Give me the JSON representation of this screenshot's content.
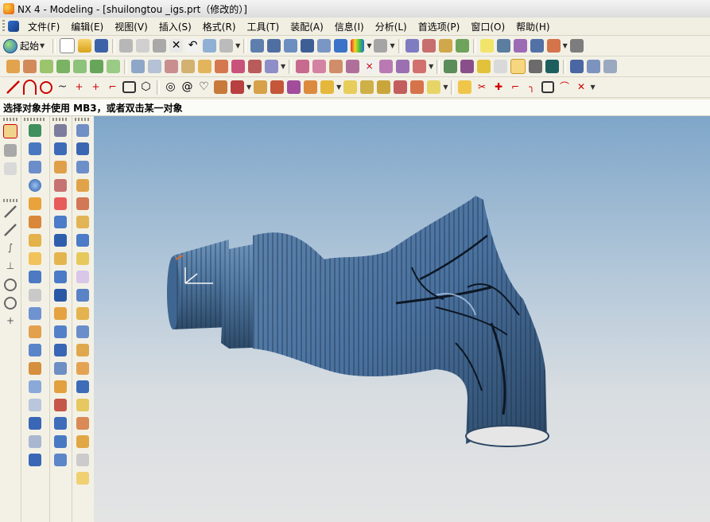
{
  "window": {
    "title": "NX 4 - Modeling - [shuilongtou _igs.prt（修改的）]"
  },
  "menu": {
    "items": [
      "文件(F)",
      "编辑(E)",
      "视图(V)",
      "插入(S)",
      "格式(R)",
      "工具(T)",
      "装配(A)",
      "信息(I)",
      "分析(L)",
      "首选项(P)",
      "窗口(O)",
      "帮助(H)"
    ]
  },
  "toolbar": {
    "start_label": "起始"
  },
  "status": {
    "prompt": "选择对象并使用 MB3，或者双击某一对象"
  },
  "colors": {
    "model_surface": "#4f77a0",
    "model_dark": "#2d4a69",
    "viewport_top": "#7fa6c9",
    "viewport_bottom": "#e4e4e4"
  }
}
